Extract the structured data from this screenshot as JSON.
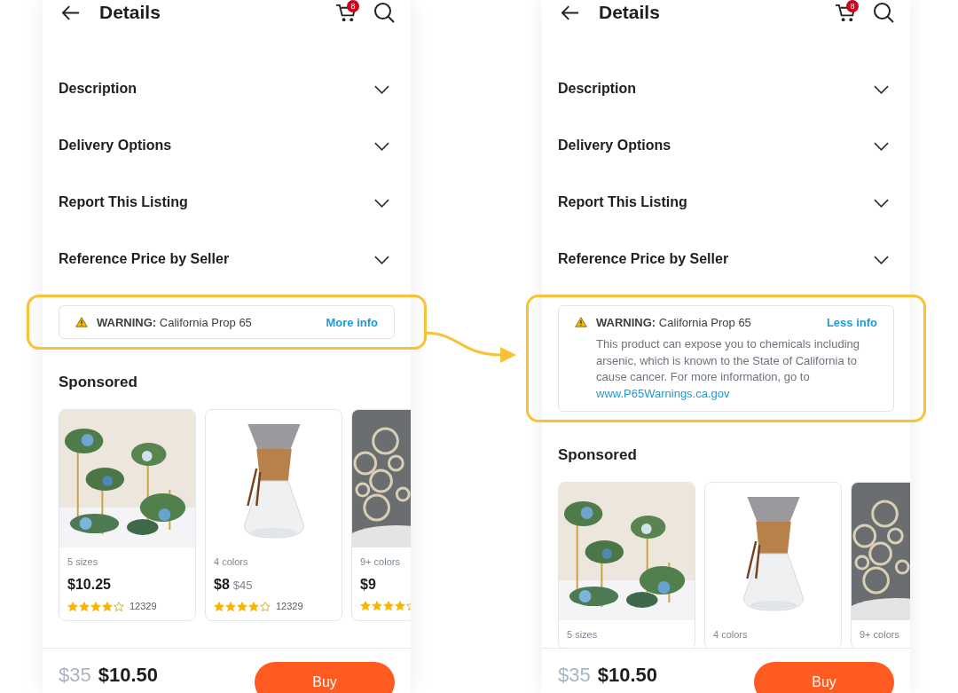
{
  "screens": [
    {
      "title": "Details",
      "cart_badge": "8",
      "sections": [
        {
          "label": "Description",
          "expanded": false
        },
        {
          "label": "Delivery Options",
          "expanded": false
        },
        {
          "label": "Report This Listing",
          "expanded": false
        },
        {
          "label": "Reference Price by Seller",
          "expanded": false
        }
      ],
      "warning": {
        "text": "**WARNING:** California Prop 65",
        "toggle": "More info",
        "expanded": false,
        "highlighted": true
      },
      "sponsored_title": "Sponsored",
      "products": [
        {
          "kind": "flowers",
          "variant": "5 sizes",
          "price": "$10.25",
          "stars": 4,
          "reviews": "12329"
        },
        {
          "kind": "carafe",
          "variant": "4 colors",
          "price": "$8",
          "old_price": "$45",
          "stars": 4,
          "reviews": "12329"
        },
        {
          "kind": "rings",
          "variant": "9+ colors",
          "price": "$9",
          "stars": 4
        }
      ],
      "bar": {
        "original_price": "$35",
        "price": "$10.50",
        "buy": "Buy"
      }
    },
    {
      "title": "Details",
      "cart_badge": "8",
      "sections": [
        {
          "label": "Description",
          "expanded": false
        },
        {
          "label": "Delivery Options",
          "expanded": false
        },
        {
          "label": "Report This Listing",
          "expanded": false
        },
        {
          "label": "Reference Price by Seller",
          "expanded": false
        }
      ],
      "warning": {
        "text": "**WARNING:** California Prop 65",
        "toggle": "Less info",
        "expanded": true,
        "highlighted": true,
        "body": "This product can expose you to chemicals including arsenic, which is known to the State of California to cause cancer. For more information, go to",
        "link": "www.P65Warnings.ca.gov"
      },
      "sponsored_title": "Sponsored",
      "products": [
        {
          "kind": "flowers",
          "variant": "5 sizes"
        },
        {
          "kind": "carafe",
          "variant": "4 colors"
        },
        {
          "kind": "rings",
          "variant": "9+ colors"
        }
      ],
      "bar": {
        "original_price": "$35",
        "price": "$10.50",
        "buy": "Buy"
      }
    }
  ]
}
